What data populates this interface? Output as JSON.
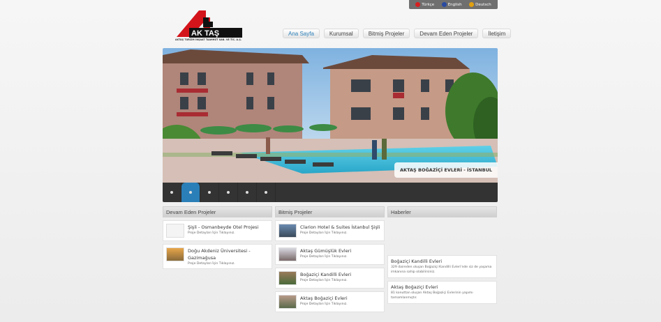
{
  "languages": [
    {
      "label": "Türkçe",
      "color": "#d62020"
    },
    {
      "label": "English",
      "color": "#2a4aa0"
    },
    {
      "label": "Deutsch",
      "color": "#e0a010"
    }
  ],
  "logo": {
    "brand": "AK TAŞ",
    "tagline": "AKTAŞ TURİZM İNŞAAT TAAHHÜT SAN. VE TİC. A.Ş."
  },
  "nav": [
    "Ana Sayfa",
    "Kurumsal",
    "Bitmiş Projeler",
    "Devam Eden Projeler",
    "İletişim"
  ],
  "slider": {
    "caption": "AKTAŞ BOĞAZİÇİ EVLERİ - İSTANBUL",
    "active_index": 1,
    "dot_count": 6
  },
  "columns": {
    "ongoing": {
      "title": "Devam Eden Projeler",
      "items": [
        {
          "title": "Şişli - Osmanbeyde Otel Projesi",
          "sub": "Proje Detayları İçin Tıklayınız."
        },
        {
          "title": "Doğu Akdeniz Üniversitesi - Gazimağusa",
          "sub": "Proje Detayları İçin Tıklayınız."
        }
      ]
    },
    "finished": {
      "title": "Bitmiş Projeler",
      "items": [
        {
          "title": "Clarion Hotel & Suites İstanbul Şişli",
          "sub": "Proje Detayları İçin Tıklayınız."
        },
        {
          "title": "Aktaş Gümüşlük Evleri",
          "sub": "Proje Detayları İçin Tıklayınız."
        },
        {
          "title": "Boğaziçi Kandilli Evleri",
          "sub": "Proje Detayları İçin Tıklayınız."
        },
        {
          "title": "Aktaş Boğaziçi Evleri",
          "sub": "Proje Detayları İçin Tıklayınız."
        }
      ]
    },
    "news": {
      "title": "Haberler",
      "items": [
        {
          "title": "Boğaziçi Kandilli Evleri",
          "text": "329 daireden oluşan Boğaziçi Kandilli Evleri'nde siz de yaşama imkanına sahip olabilirsiniz."
        },
        {
          "title": "Aktaş Boğaziçi Evleri",
          "text": "81 konuttan oluşan Aktaş Boğaziçi Evlerinin yapımı tamamlanmıştır."
        }
      ]
    }
  },
  "colors": {
    "accent": "#2b7fb8",
    "logo_red": "#d4141b"
  }
}
